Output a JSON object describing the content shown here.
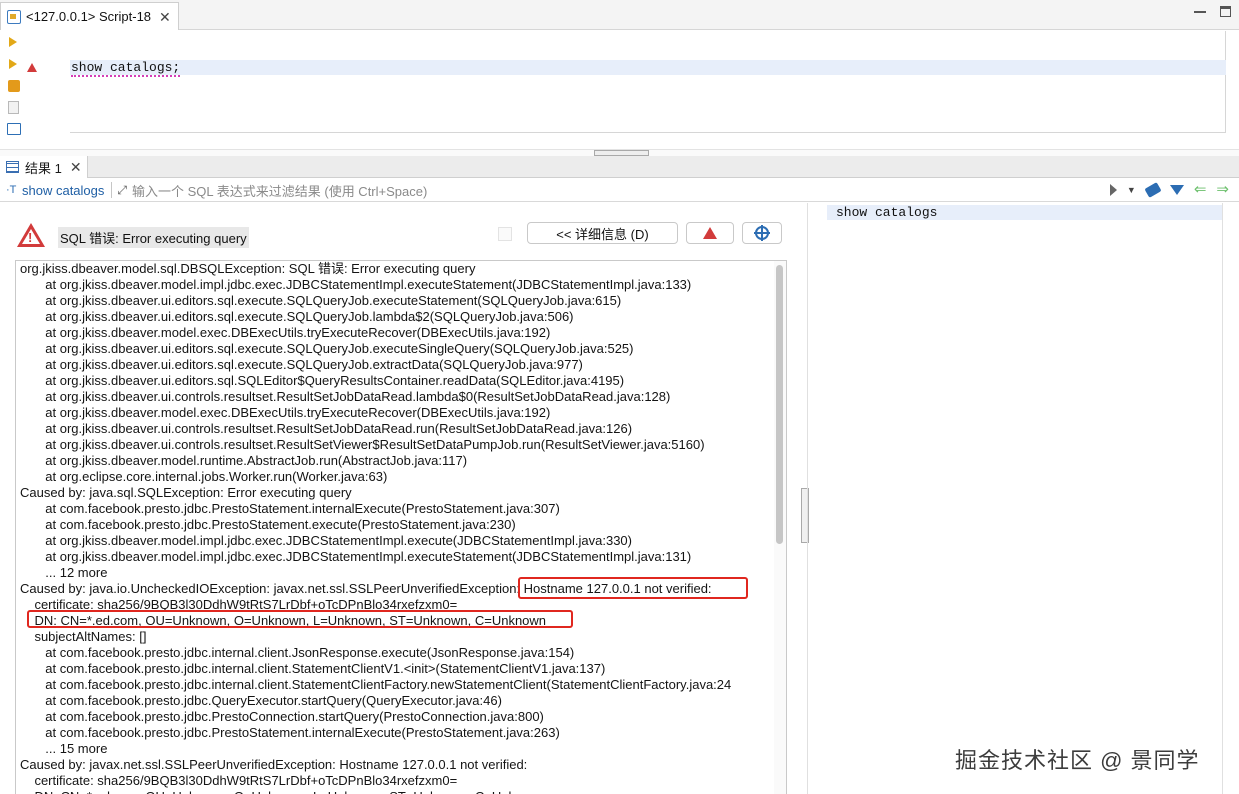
{
  "editor_tab": {
    "label": "<127.0.0.1> Script-18",
    "close": "✕"
  },
  "editor": {
    "line": "show catalogs;"
  },
  "results_tab": {
    "label": "结果 1",
    "close": "✕"
  },
  "filter": {
    "query_label": "show catalogs",
    "placeholder": "输入一个 SQL 表达式来过滤结果 (使用 Ctrl+Space)"
  },
  "error": {
    "title": "SQL 错误: Error executing query",
    "details_button": "<< 详细信息 (D)"
  },
  "stack_trace": [
    "org.jkiss.dbeaver.model.sql.DBSQLException: SQL 错误: Error executing query",
    "\tat org.jkiss.dbeaver.model.impl.jdbc.exec.JDBCStatementImpl.executeStatement(JDBCStatementImpl.java:133)",
    "\tat org.jkiss.dbeaver.ui.editors.sql.execute.SQLQueryJob.executeStatement(SQLQueryJob.java:615)",
    "\tat org.jkiss.dbeaver.ui.editors.sql.execute.SQLQueryJob.lambda$2(SQLQueryJob.java:506)",
    "\tat org.jkiss.dbeaver.model.exec.DBExecUtils.tryExecuteRecover(DBExecUtils.java:192)",
    "\tat org.jkiss.dbeaver.ui.editors.sql.execute.SQLQueryJob.executeSingleQuery(SQLQueryJob.java:525)",
    "\tat org.jkiss.dbeaver.ui.editors.sql.execute.SQLQueryJob.extractData(SQLQueryJob.java:977)",
    "\tat org.jkiss.dbeaver.ui.editors.sql.SQLEditor$QueryResultsContainer.readData(SQLEditor.java:4195)",
    "\tat org.jkiss.dbeaver.ui.controls.resultset.ResultSetJobDataRead.lambda$0(ResultSetJobDataRead.java:128)",
    "\tat org.jkiss.dbeaver.model.exec.DBExecUtils.tryExecuteRecover(DBExecUtils.java:192)",
    "\tat org.jkiss.dbeaver.ui.controls.resultset.ResultSetJobDataRead.run(ResultSetJobDataRead.java:126)",
    "\tat org.jkiss.dbeaver.ui.controls.resultset.ResultSetViewer$ResultSetDataPumpJob.run(ResultSetViewer.java:5160)",
    "\tat org.jkiss.dbeaver.model.runtime.AbstractJob.run(AbstractJob.java:117)",
    "\tat org.eclipse.core.internal.jobs.Worker.run(Worker.java:63)",
    "Caused by: java.sql.SQLException: Error executing query",
    "\tat com.facebook.presto.jdbc.PrestoStatement.internalExecute(PrestoStatement.java:307)",
    "\tat com.facebook.presto.jdbc.PrestoStatement.execute(PrestoStatement.java:230)",
    "\tat org.jkiss.dbeaver.model.impl.jdbc.exec.JDBCStatementImpl.execute(JDBCStatementImpl.java:330)",
    "\tat org.jkiss.dbeaver.model.impl.jdbc.exec.JDBCStatementImpl.executeStatement(JDBCStatementImpl.java:131)",
    "\t... 12 more",
    "Caused by: java.io.UncheckedIOException: javax.net.ssl.SSLPeerUnverifiedException: Hostname 127.0.0.1 not verified:",
    "    certificate: sha256/9BQB3l30DdhW9tRtS7LrDbf+oTcDPnBlo34rxefzxm0=",
    "    DN: CN=*.ed.com, OU=Unknown, O=Unknown, L=Unknown, ST=Unknown, C=Unknown",
    "    subjectAltNames: []",
    "\tat com.facebook.presto.jdbc.internal.client.JsonResponse.execute(JsonResponse.java:154)",
    "\tat com.facebook.presto.jdbc.internal.client.StatementClientV1.<init>(StatementClientV1.java:137)",
    "\tat com.facebook.presto.jdbc.internal.client.StatementClientFactory.newStatementClient(StatementClientFactory.java:24",
    "\tat com.facebook.presto.jdbc.QueryExecutor.startQuery(QueryExecutor.java:46)",
    "\tat com.facebook.presto.jdbc.PrestoConnection.startQuery(PrestoConnection.java:800)",
    "\tat com.facebook.presto.jdbc.PrestoStatement.internalExecute(PrestoStatement.java:263)",
    "\t... 15 more",
    "Caused by: javax.net.ssl.SSLPeerUnverifiedException: Hostname 127.0.0.1 not verified:",
    "    certificate: sha256/9BQB3l30DdhW9tRtS7LrDbf+oTcDPnBlo34rxefzxm0=",
    "    DN: CN=*.ed.com, OU=Unknown, O=Unknown, L=Unknown, ST=Unknown, C=Unknown"
  ],
  "right_panel": {
    "query": "show catalogs"
  },
  "watermark": "掘金技术社区 @ 景同学",
  "colors": {
    "highlight": "#e0271f",
    "link": "#1f5fa5",
    "error": "#d23b3b"
  }
}
